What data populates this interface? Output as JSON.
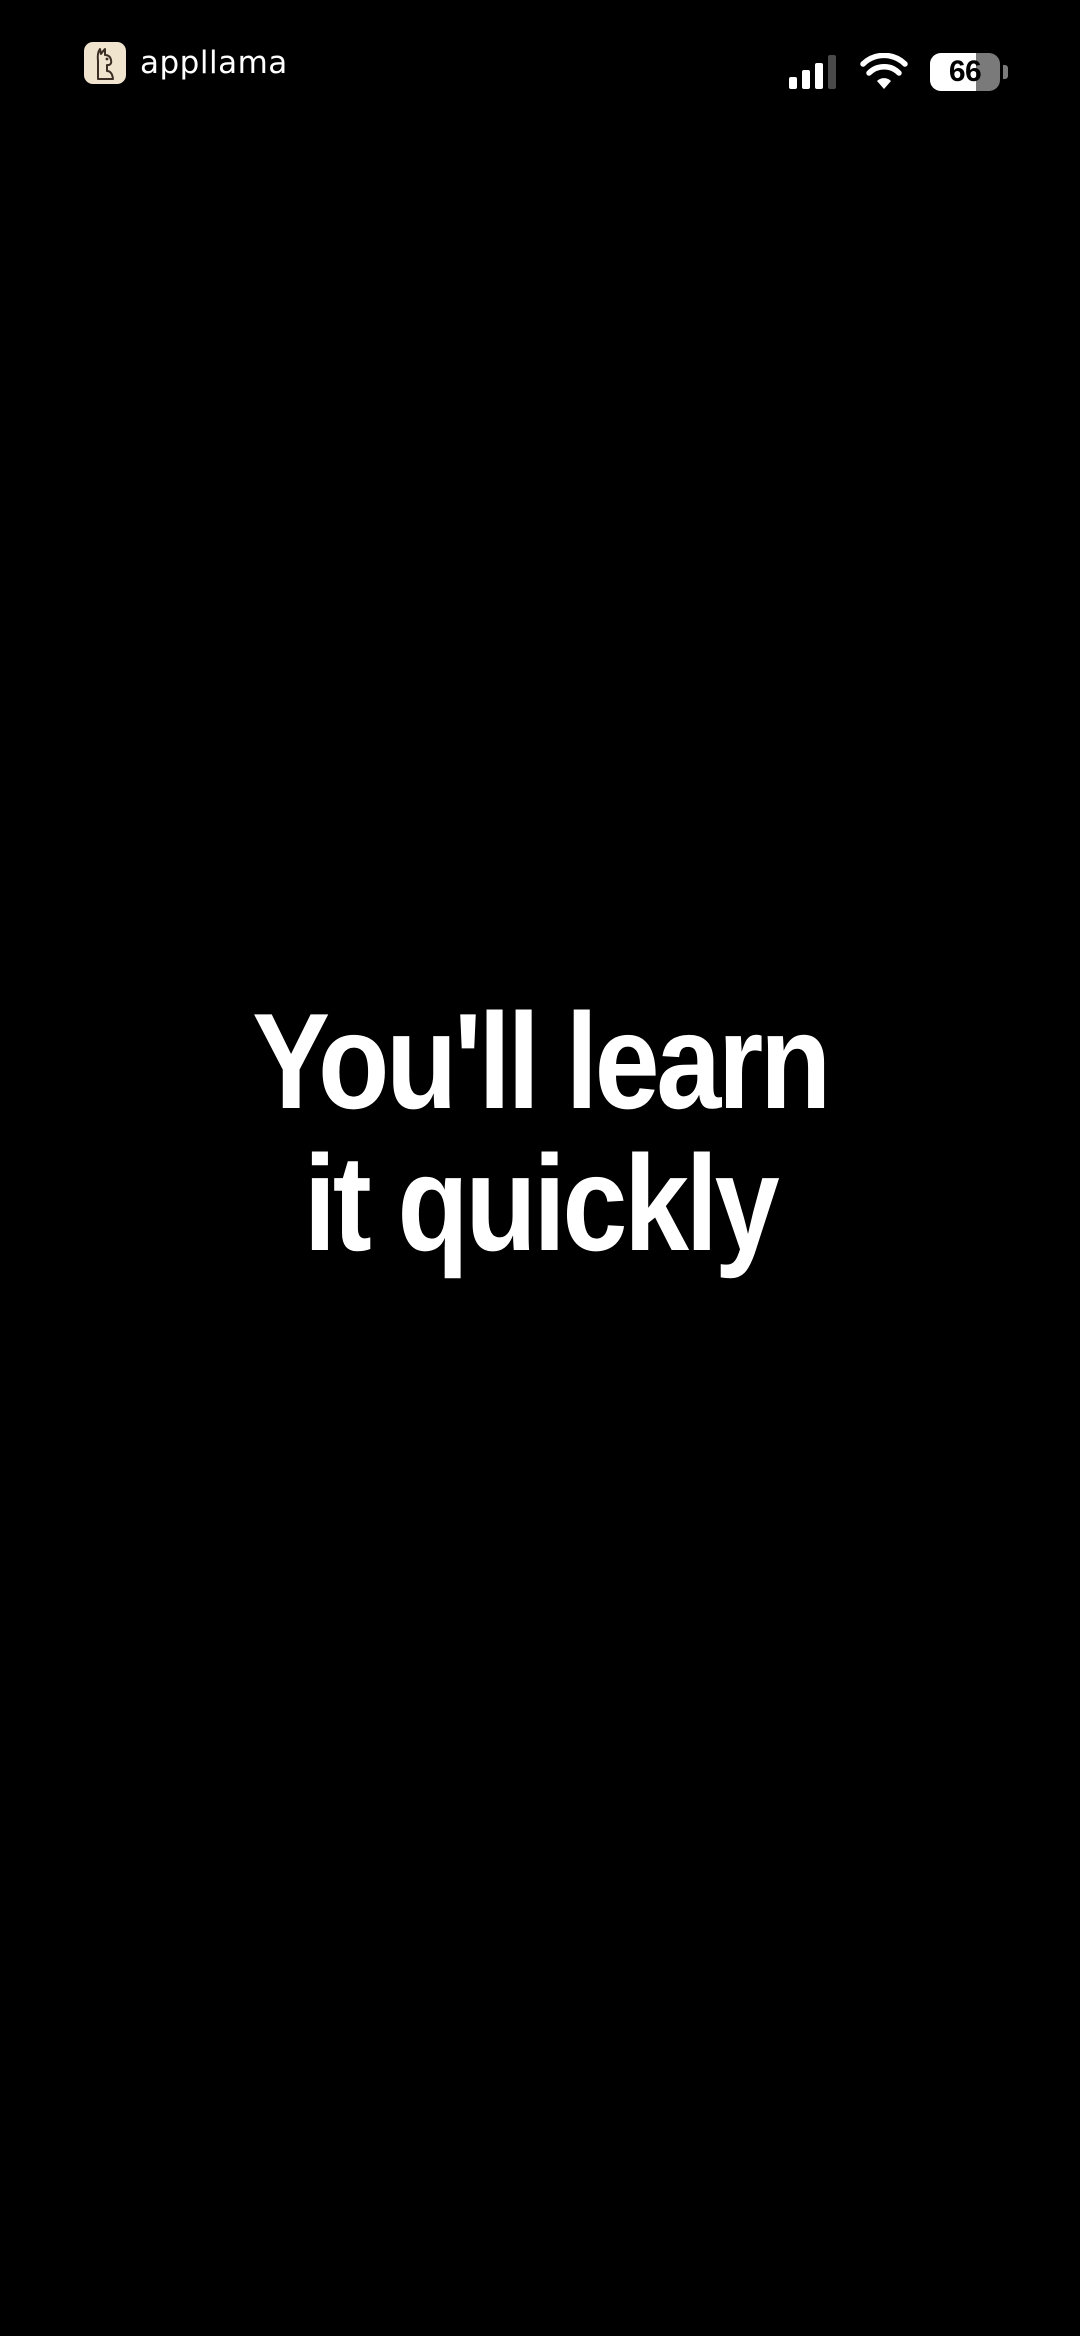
{
  "status_bar": {
    "brand": {
      "name": "appllama",
      "logo_icon": "llama-icon",
      "logo_bg": "#f1e4cf"
    },
    "signal_bars_active": 3,
    "signal_bars_total": 4,
    "wifi_icon": "wifi-icon",
    "battery": {
      "level": "66",
      "fill_fraction": 0.66
    }
  },
  "main": {
    "headline_lines": [
      "You'll learn",
      "it quickly"
    ]
  },
  "colors": {
    "background": "#000000",
    "text": "#ffffff"
  }
}
